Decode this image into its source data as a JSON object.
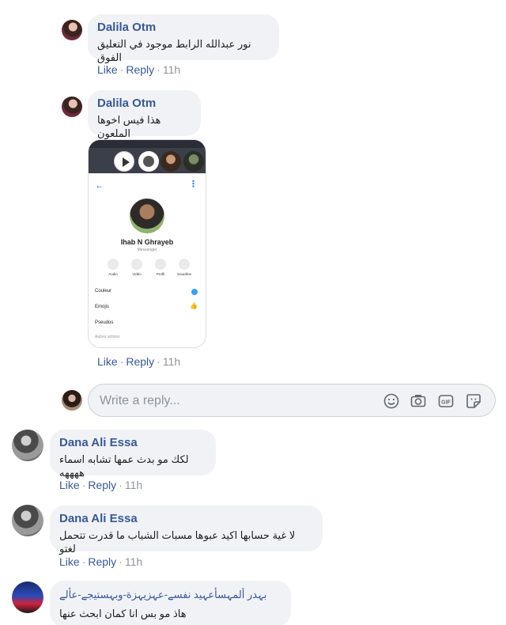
{
  "comments": [
    {
      "author": "Dalila Otm",
      "text": "نور عبدالله الرابط موجود في التعليق الفوق",
      "like": "Like",
      "reply": "Reply",
      "time": "11h"
    },
    {
      "author": "Dalila Otm",
      "text": "هذا فيس اخوها الملعون",
      "like": "Like",
      "reply": "Reply",
      "time": "11h",
      "attachment": {
        "profile_name": "Ihab N Ghrayeb",
        "profile_sub": "Messenger",
        "actions": [
          "Audio",
          "Vidéo",
          "Profil",
          "Sourdine"
        ],
        "options": [
          "Couleur",
          "Emojis",
          "Pseudos"
        ],
        "section": "Autres actions"
      }
    },
    {
      "author": "Dana Ali Essa",
      "text": "لكك مو بدث عمها تشابه اسماء ههههه",
      "like": "Like",
      "reply": "Reply",
      "time": "11h"
    },
    {
      "author": "Dana Ali Essa",
      "text": "لا غية حسابها اكيد عبوها مسبات الشباب ما قدرت تتحمل لغتو",
      "like": "Like",
      "reply": "Reply",
      "time": "11h"
    },
    {
      "author": "بہدر ألمہسأعہيد نفسے-عہزيہزة-وبہستيجے-عألے",
      "text": "هاذ مو بس انا كمان ابحث عنها"
    }
  ],
  "reply_box": {
    "placeholder": "Write a reply...",
    "icons": [
      "emoji-icon",
      "camera-icon",
      "gif-icon",
      "sticker-icon"
    ]
  },
  "colors": {
    "name": "#385898",
    "bubble": "#f0f2f5",
    "meta": "#90949c"
  }
}
